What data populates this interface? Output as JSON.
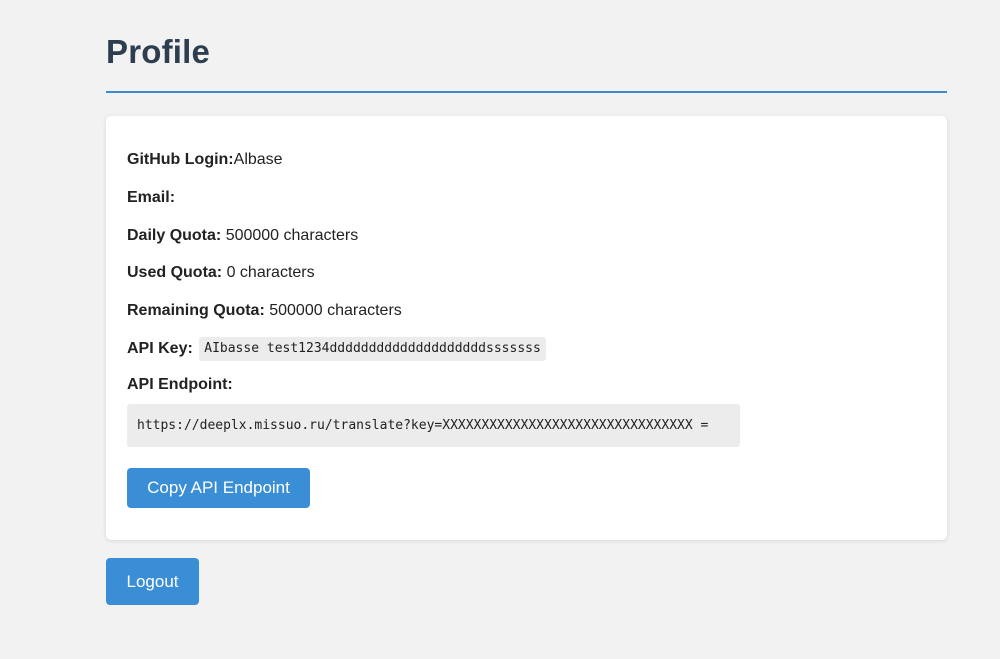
{
  "page": {
    "title": "Profile"
  },
  "profile": {
    "github_login_label": "GitHub Login:",
    "github_login_value": "Albase",
    "email_label": "Email:",
    "email_value": "",
    "daily_quota_label": "Daily Quota:",
    "daily_quota_value": "500000 characters",
    "used_quota_label": "Used Quota:",
    "used_quota_value": "0 characters",
    "remaining_quota_label": "Remaining Quota:",
    "remaining_quota_value": "500000 characters",
    "api_key_label": "API Key:",
    "api_key_value": "AIbasse test1234ddddddddddddddddddddsssssss",
    "api_endpoint_label": "API Endpoint:",
    "api_endpoint_value": "https://deeplx.missuo.ru/translate?key=XXXXXXXXXXXXXXXXXXXXXXXXXXXXXXXX ="
  },
  "actions": {
    "copy_endpoint_label": "Copy API Endpoint",
    "logout_label": "Logout"
  },
  "colors": {
    "accent": "#3a8ed6",
    "title": "#2c3e50",
    "rule": "#3a8ecf",
    "background": "#f2f2f2",
    "card": "#ffffff",
    "code_background": "#ececec"
  }
}
